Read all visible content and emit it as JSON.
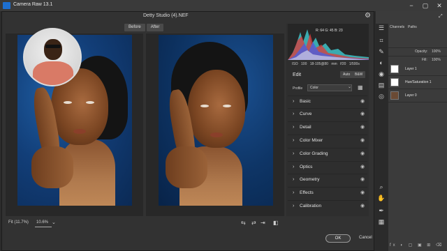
{
  "app": {
    "title": "Camera Raw 13.1"
  },
  "window": {
    "file_name": "Detty Studio (4).NEF"
  },
  "compare": {
    "before_label": "Before",
    "after_label": "After"
  },
  "histogram": {
    "readout": "R: 64   G: 45   B: 23"
  },
  "camera_info": {
    "iso": "ISO 100",
    "lens": "18-105@80 mm",
    "aperture": "f/20",
    "shutter": "1/500s"
  },
  "edit": {
    "heading": "Edit",
    "auto_label": "Auto",
    "bw_label": "B&W",
    "profile_label": "Profile",
    "profile_value": "Color"
  },
  "sections": [
    {
      "label": "Basic"
    },
    {
      "label": "Curve"
    },
    {
      "label": "Detail"
    },
    {
      "label": "Color Mixer"
    },
    {
      "label": "Color Grading"
    },
    {
      "label": "Optics"
    },
    {
      "label": "Geometry"
    },
    {
      "label": "Effects"
    },
    {
      "label": "Calibration"
    }
  ],
  "zoom": {
    "fit_label": "Fit (11.7%)",
    "value": "10.6%"
  },
  "footer": {
    "ok_label": "OK",
    "cancel_label": "Cancel"
  },
  "ps_panel": {
    "tabs": [
      "Channels",
      "Paths"
    ],
    "opacity_label": "Opacity:",
    "opacity_value": "100%",
    "fill_label": "Fill:",
    "fill_value": "100%",
    "layers": [
      {
        "name": "Layer 1"
      },
      {
        "name": "Hue/Saturation 1"
      },
      {
        "name": "Layer 0"
      }
    ]
  }
}
